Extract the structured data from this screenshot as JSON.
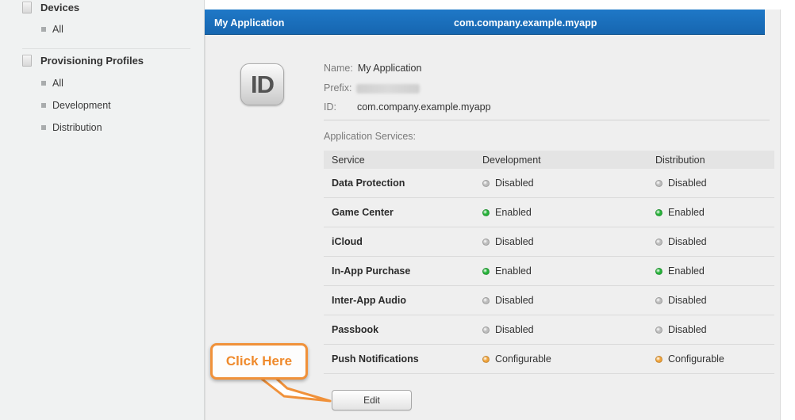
{
  "sidebar": {
    "sections": [
      {
        "title": "Devices",
        "items": [
          "All"
        ]
      },
      {
        "title": "Provisioning Profiles",
        "items": [
          "All",
          "Development",
          "Distribution"
        ]
      }
    ]
  },
  "header": {
    "app_name": "My Application",
    "app_id": "com.company.example.myapp"
  },
  "details": {
    "icon_text": "ID",
    "name_label": "Name:",
    "name_value": "My Application",
    "prefix_label": "Prefix:",
    "id_label": "ID:",
    "id_value": "com.company.example.myapp"
  },
  "services": {
    "title": "Application Services:",
    "columns": [
      "Service",
      "Development",
      "Distribution"
    ],
    "rows": [
      {
        "name": "Data Protection",
        "dev": "Disabled",
        "dist": "Disabled"
      },
      {
        "name": "Game Center",
        "dev": "Enabled",
        "dist": "Enabled"
      },
      {
        "name": "iCloud",
        "dev": "Disabled",
        "dist": "Disabled"
      },
      {
        "name": "In-App Purchase",
        "dev": "Enabled",
        "dist": "Enabled"
      },
      {
        "name": "Inter-App Audio",
        "dev": "Disabled",
        "dist": "Disabled"
      },
      {
        "name": "Passbook",
        "dev": "Disabled",
        "dist": "Disabled"
      },
      {
        "name": "Push Notifications",
        "dev": "Configurable",
        "dist": "Configurable"
      }
    ],
    "status_colors": {
      "Disabled": "#bdbdbd",
      "Enabled": "#27b33a",
      "Configurable": "#f0a33a"
    }
  },
  "actions": {
    "edit_label": "Edit"
  },
  "callout": {
    "text": "Click Here",
    "color": "#f0913a"
  },
  "colors": {
    "header_blue": "#1a6fbf",
    "card_bg": "#efefef"
  }
}
